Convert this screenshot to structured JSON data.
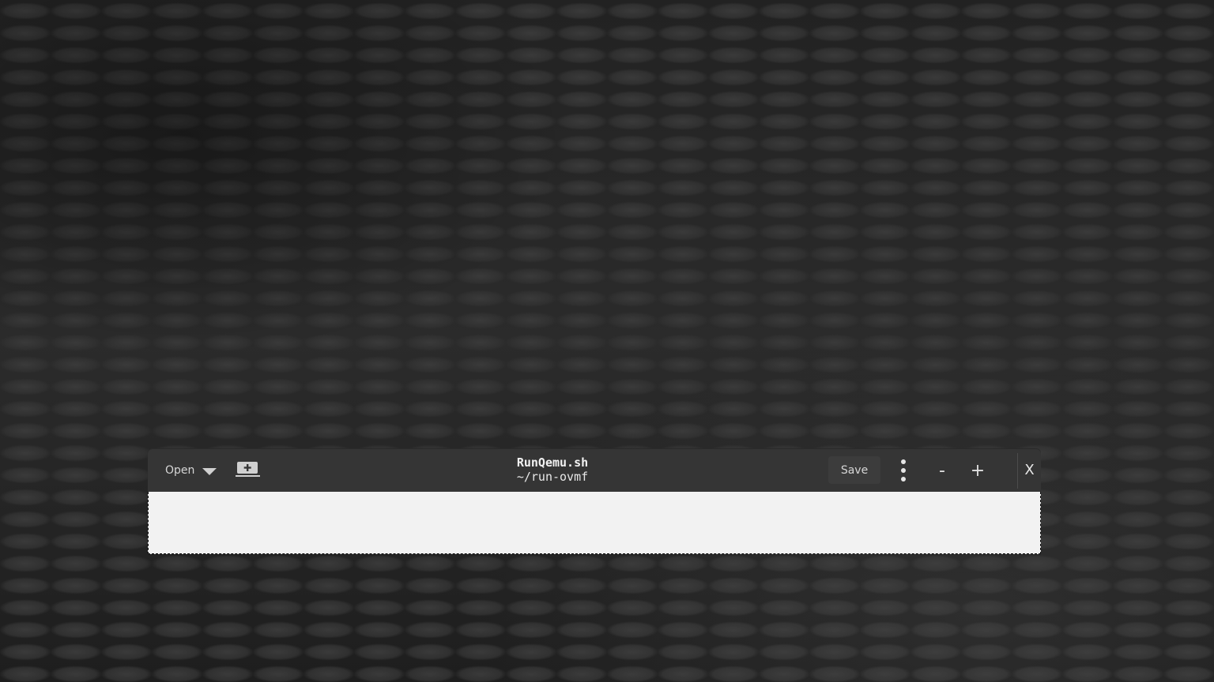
{
  "window": {
    "title": "RunQemu.sh",
    "subtitle": "~/run-ovmf"
  },
  "headerbar": {
    "open_label": "Open",
    "open_icon": "chevron-down-icon",
    "new_document_icon": "new-document-icon",
    "save_label": "Save",
    "menu_icon": "vertical-dots-icon",
    "zoom_out_label": "-",
    "zoom_in_label": "+",
    "close_label": "X"
  },
  "editor": {
    "content": ""
  },
  "colors": {
    "headerbar_bg": "#353535",
    "editor_bg": "#f2f2f2",
    "wallpaper": "#2b2b2b"
  }
}
